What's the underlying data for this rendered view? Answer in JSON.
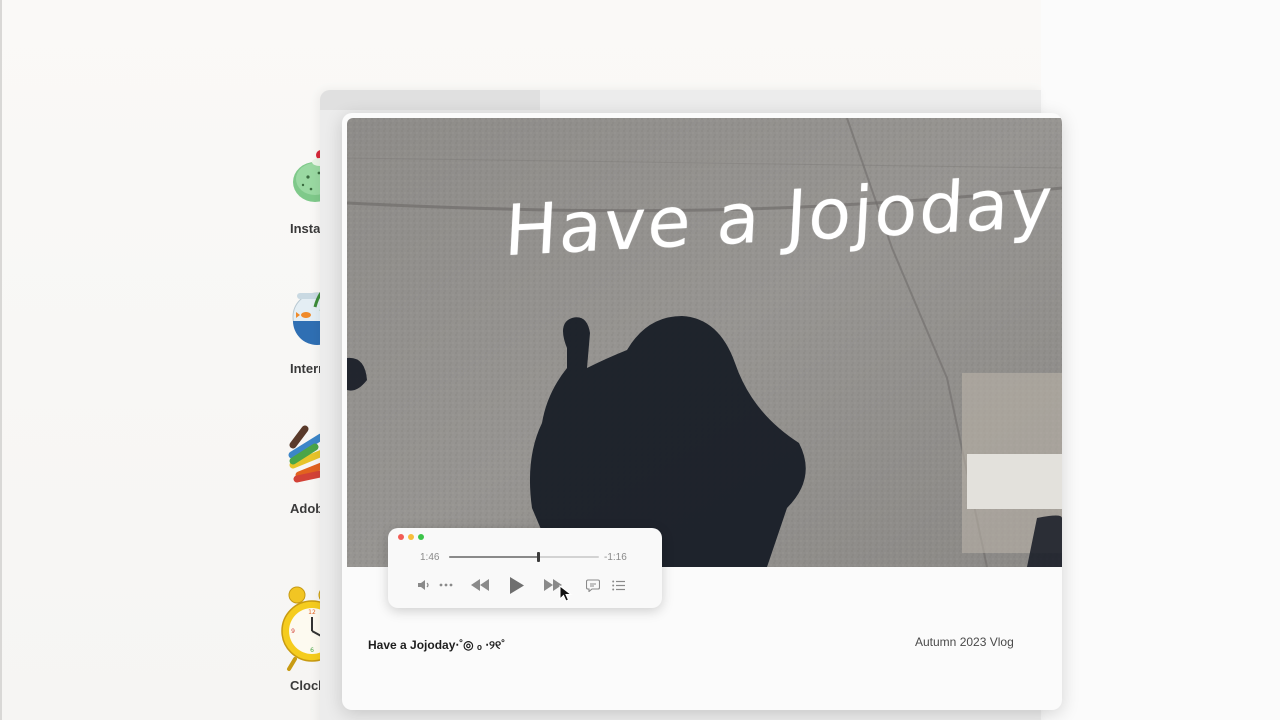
{
  "desktop_icons": [
    {
      "name": "instagram",
      "label": "Insta"
    },
    {
      "name": "internet",
      "label": "Intern"
    },
    {
      "name": "adobe",
      "label": "Adobe"
    },
    {
      "name": "clock",
      "label": "Clock"
    }
  ],
  "video": {
    "overlay_text": "Have a Jojoday"
  },
  "caption": {
    "title": "Have a Jojoday⋅˚◎ ₒ ⋅୨୧˚",
    "series": "Autumn 2023 Vlog"
  },
  "player": {
    "elapsed": "1:46",
    "remaining": "-1:16",
    "progress": 0.59,
    "icons": [
      "volume-icon",
      "more-icon",
      "rewind-icon",
      "play-icon",
      "fast-forward-icon",
      "subtitles-icon",
      "playlist-icon"
    ]
  },
  "colors": {
    "traffic_red": "#f25c55",
    "traffic_yellow": "#f7bd3b",
    "traffic_green": "#3cc44a"
  }
}
